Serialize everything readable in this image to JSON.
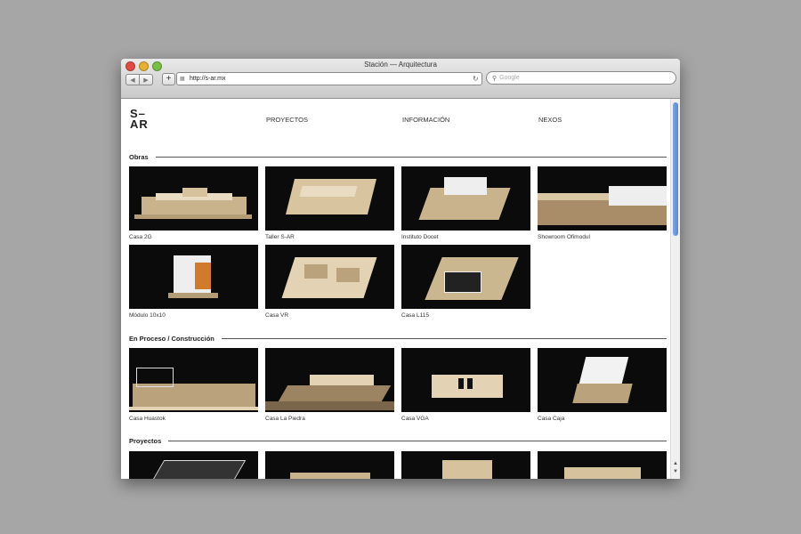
{
  "window": {
    "title": "Stación — Arquitectura"
  },
  "toolbar": {
    "back": "◀",
    "forward": "▶",
    "add": "+",
    "url": "http://s-ar.mx",
    "reload": "↻",
    "search_placeholder": "Google",
    "search_icon": "⚲"
  },
  "site": {
    "logo_line1": "S–",
    "logo_line2": "AR",
    "nav": [
      "PROYECTOS",
      "INFORMACIÓN",
      "NEXOS"
    ]
  },
  "sections": {
    "obras": {
      "title": "Obras",
      "items": [
        "Casa 2G",
        "Taller S-AR",
        "Instituto Docet",
        "Showroom Ofimodul",
        "Módulo 10x10",
        "Casa VR",
        "Casa L115"
      ]
    },
    "proceso": {
      "title": "En Proceso / Construcción",
      "items": [
        "Casa Huastok",
        "Casa La Piedra",
        "Casa VGA",
        "Casa Caja"
      ]
    },
    "proyectos": {
      "title": "Proyectos"
    }
  },
  "colors": {
    "accent": "#5a88d4",
    "tile_bg": "#0b0b0b",
    "model_wood": "#c9b38c"
  }
}
